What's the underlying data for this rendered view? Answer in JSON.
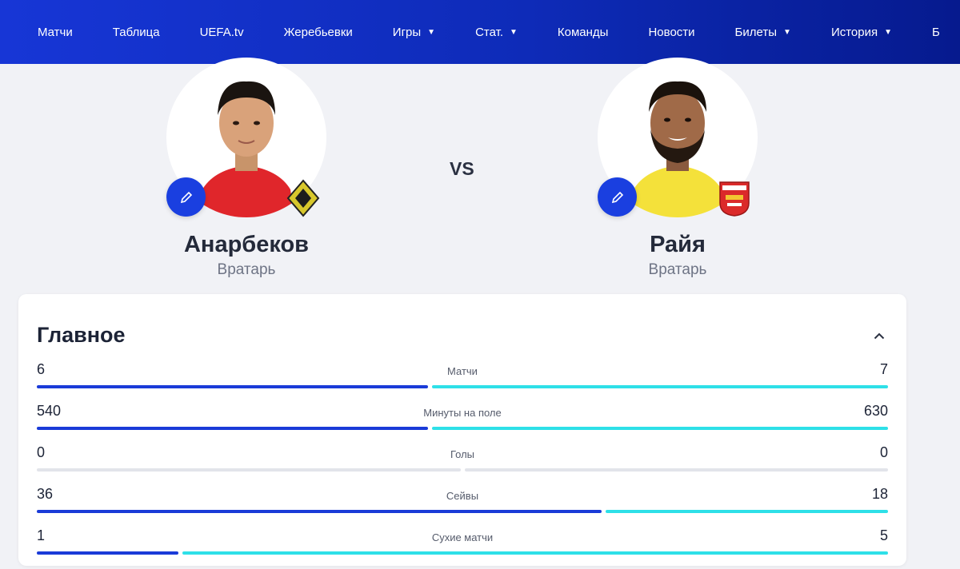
{
  "nav": {
    "items": [
      {
        "label": "Матчи",
        "caret": false
      },
      {
        "label": "Таблица",
        "caret": false
      },
      {
        "label": "UEFA.tv",
        "caret": false
      },
      {
        "label": "Жеребьевки",
        "caret": false
      },
      {
        "label": "Игры",
        "caret": true
      },
      {
        "label": "Стат.",
        "caret": true
      },
      {
        "label": "Команды",
        "caret": false
      },
      {
        "label": "Новости",
        "caret": false
      },
      {
        "label": "Билеты",
        "caret": true
      },
      {
        "label": "История",
        "caret": true
      },
      {
        "label": "Б",
        "caret": false
      }
    ],
    "caret_glyph": "▼"
  },
  "comparison": {
    "vs_label": "VS",
    "player1": {
      "name": "Анарбеков",
      "position": "Вратарь",
      "shirt_color": "#e0262b"
    },
    "player2": {
      "name": "Райя",
      "position": "Вратарь",
      "shirt_color": "#f4e13a"
    }
  },
  "stats_section": {
    "title": "Главное",
    "collapse_icon": "chevron-up-icon",
    "rows": [
      {
        "label": "Матчи",
        "left": "6",
        "right": "7",
        "left_share": 0.462,
        "highlighted": true
      },
      {
        "label": "Минуты на поле",
        "left": "540",
        "right": "630",
        "left_share": 0.462,
        "highlighted": true
      },
      {
        "label": "Голы",
        "left": "0",
        "right": "0",
        "left_share": 0.5,
        "highlighted": false
      },
      {
        "label": "Сейвы",
        "left": "36",
        "right": "18",
        "left_share": 0.667,
        "highlighted": true
      },
      {
        "label": "Сухие матчи",
        "left": "1",
        "right": "5",
        "left_share": 0.167,
        "highlighted": true
      }
    ]
  },
  "colors": {
    "left_bar": "#1a3bd8",
    "right_bar": "#2ee0e8",
    "empty_bar": "#e2e4ea",
    "nav_bg": "#1230c8",
    "edit_button": "#1a3fe0"
  }
}
